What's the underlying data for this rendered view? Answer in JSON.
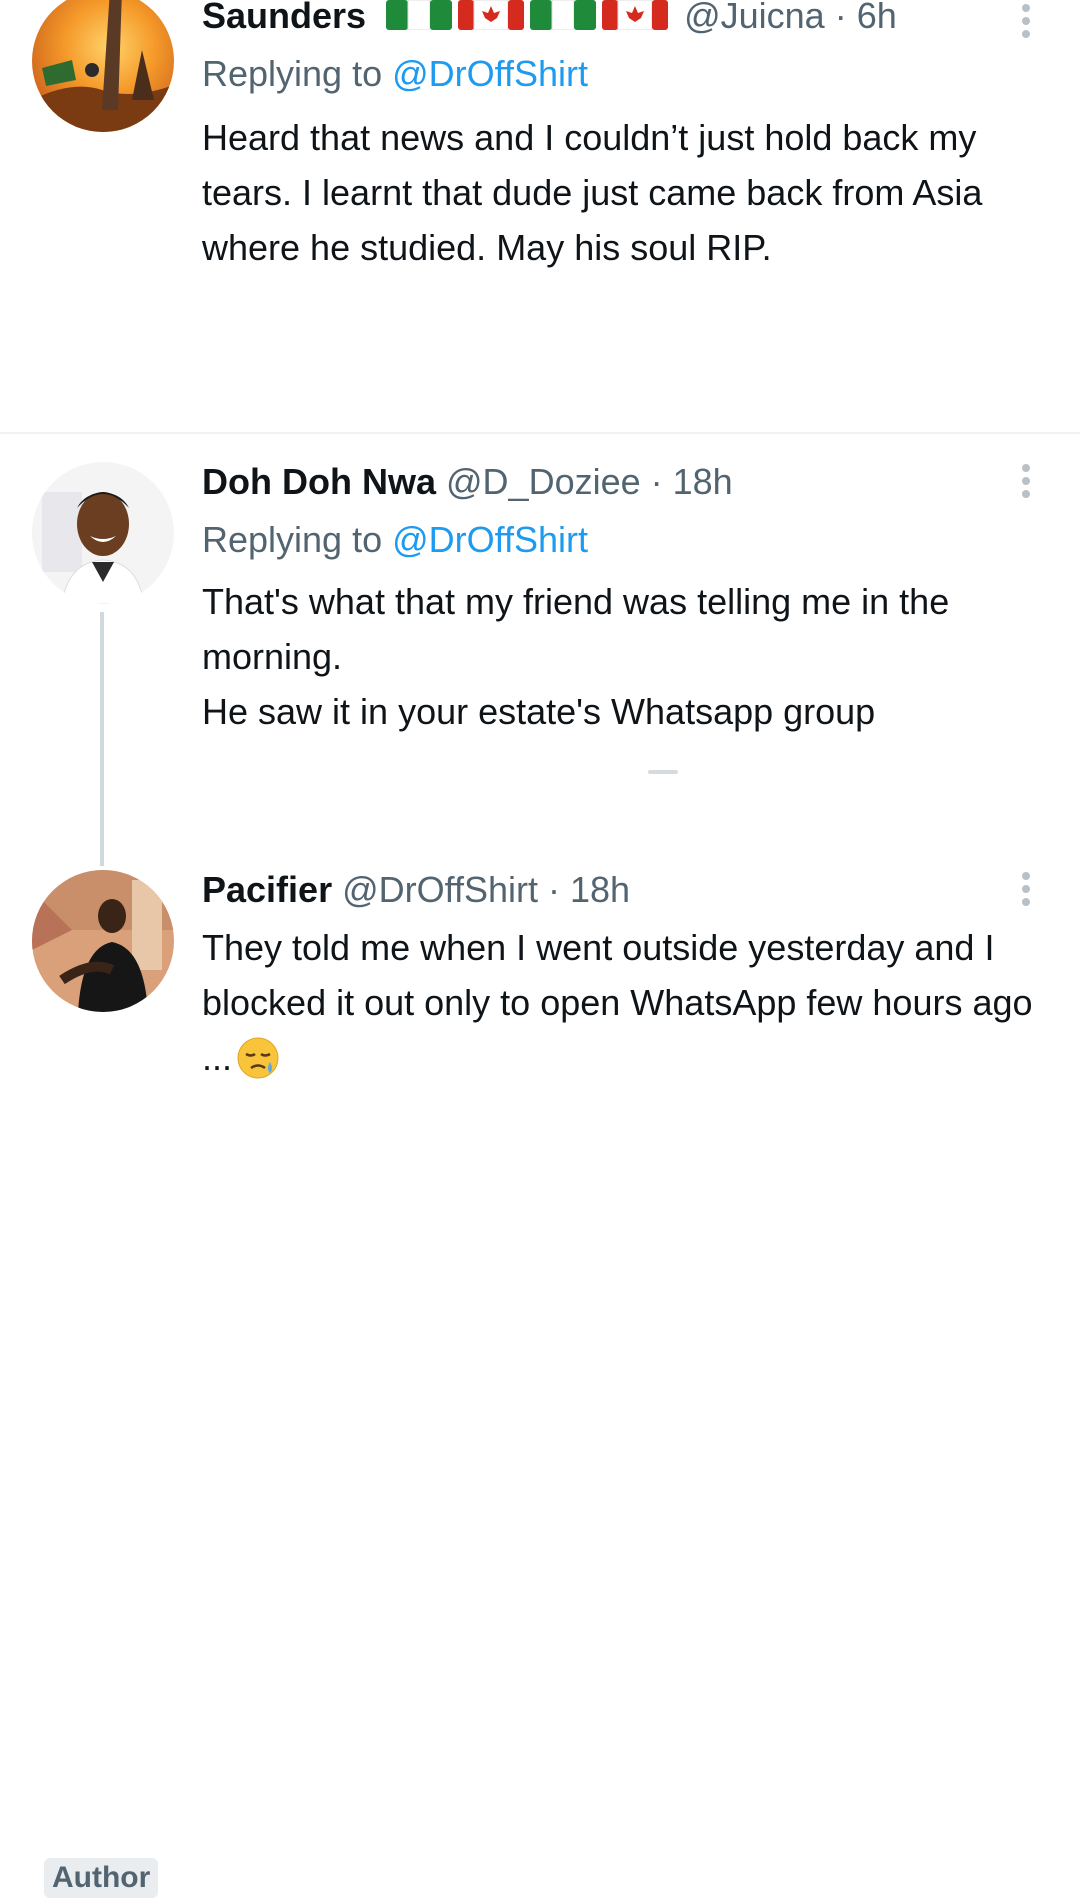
{
  "tweets": [
    {
      "name": "Saunders",
      "handle": "@Juicna",
      "time": "6h",
      "reply_prefix": "Replying to ",
      "reply_to": "@DrOffShirt",
      "text": "Heard that news and I couldn’t just hold back my tears. I learnt that dude just came back from Asia where he studied. May his soul RIP.",
      "flags": [
        "nigeria-flag-icon",
        "canada-flag-icon",
        "nigeria-flag-icon",
        "canada-flag-icon"
      ]
    },
    {
      "name": "Doh Doh Nwa",
      "handle": "@D_Doziee",
      "time": "18h",
      "reply_prefix": "Replying to ",
      "reply_to": "@DrOffShirt",
      "text_lines": [
        "That's what that my friend was telling me in the morning.",
        "He saw it in your estate's Whatsapp group"
      ]
    },
    {
      "name": "Pacifier",
      "handle": "@DrOffShirt",
      "time": "18h",
      "badge": "Author",
      "text": "They told me when I went outside yesterday and I blocked it out only to open WhatsApp few hours ago ...",
      "emoji": "sad-tear-face-emoji"
    }
  ],
  "separator": " · ",
  "colors": {
    "name": "#0f1419",
    "meta": "#536471",
    "mention": "#1d9bf0",
    "thread_line": "#cfd9de"
  }
}
